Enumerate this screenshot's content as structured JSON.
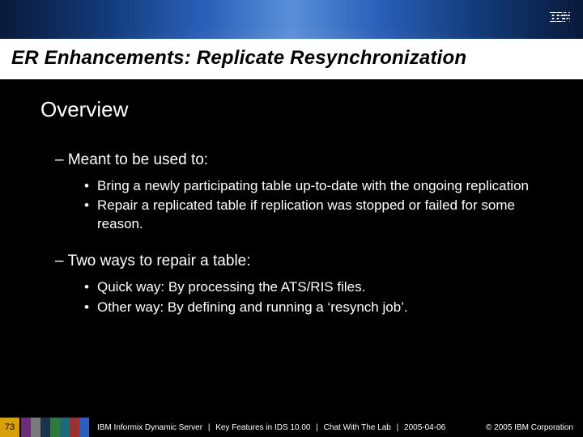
{
  "header": {
    "logo_text": "IBM"
  },
  "title": "ER Enhancements: Replicate Resynchronization",
  "overview_label": "Overview",
  "sections": [
    {
      "heading": "Meant to be used to:",
      "bullets": [
        "Bring a newly participating table up-to-date with the ongoing replication",
        "Repair a replicated table if replication was stopped or failed for some reason."
      ]
    },
    {
      "heading": "Two ways to repair a table:",
      "bullets": [
        "Quick way: By processing the ATS/RIS files.",
        "Other way: By defining and running a ‘resynch job’."
      ]
    }
  ],
  "footer": {
    "page_number": "73",
    "crumb1": "IBM Informix Dynamic Server",
    "crumb2": "Key Features in IDS 10.00",
    "crumb3": "Chat With The Lab",
    "crumb4": "2005-04-06",
    "separator": "|",
    "copyright": "© 2005 IBM Corporation"
  }
}
